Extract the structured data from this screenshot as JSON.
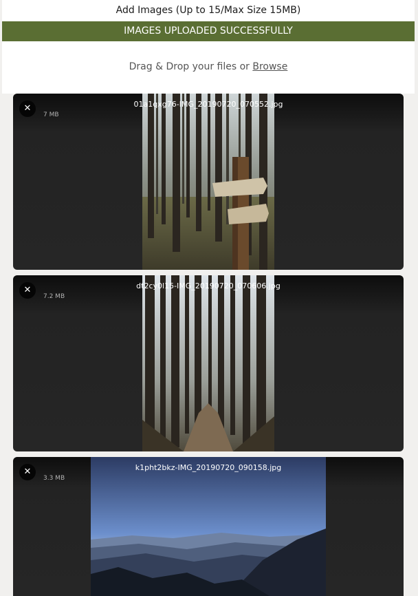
{
  "uploader": {
    "title": "Add Images (Up to 15/Max Size 15MB)",
    "status": "IMAGES UPLOADED SUCCESSFULLY",
    "drop_text": "Drag & Drop your files or ",
    "browse_label": "Browse"
  },
  "files": [
    {
      "name": "01a1qxg76-IMG_20190720_070552.jpg",
      "size": "7 MB",
      "remove_icon": "close-icon"
    },
    {
      "name": "dt2cy0l15-IMG_20190720_070606.jpg",
      "size": "7.2 MB",
      "remove_icon": "close-icon"
    },
    {
      "name": "k1pht2bkz-IMG_20190720_090158.jpg",
      "size": "3.3 MB",
      "remove_icon": "close-icon"
    }
  ],
  "colors": {
    "banner": "#5a6e33",
    "card": "#262626",
    "page": "#f1f0ee"
  }
}
